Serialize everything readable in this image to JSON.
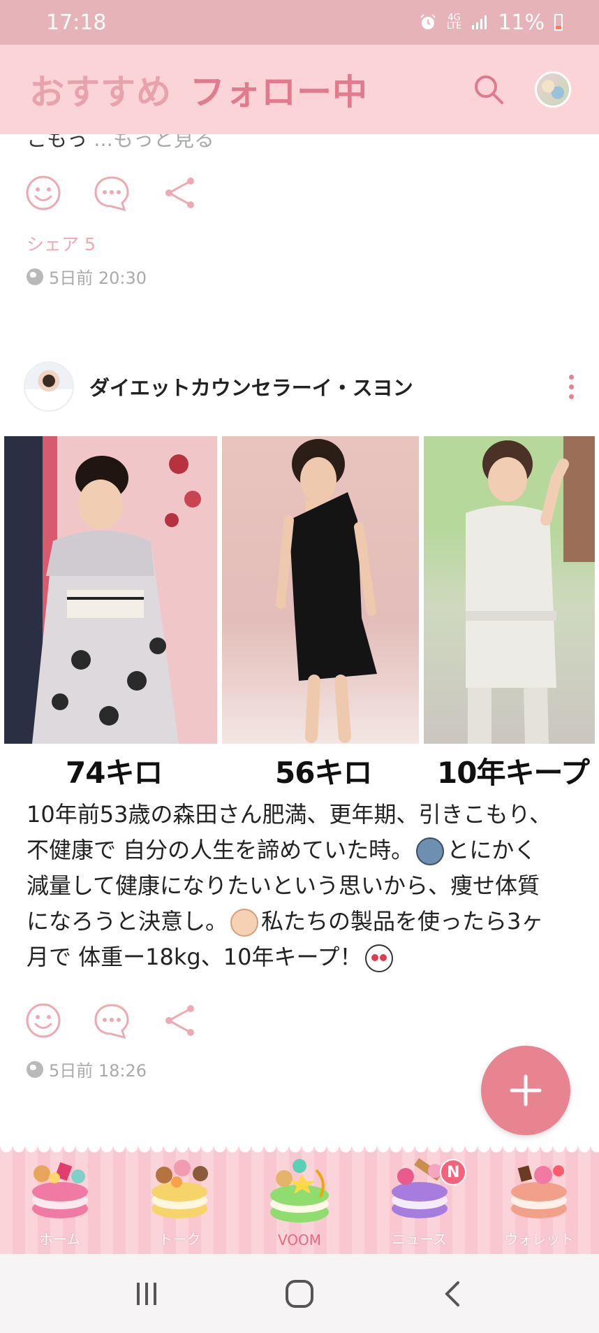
{
  "status_bar": {
    "time": "17:18",
    "network": "4G",
    "network_sub": "LTE",
    "battery": "11%"
  },
  "header": {
    "tab_recommended": "おすすめ",
    "tab_following": "フォロー中"
  },
  "prev_post": {
    "clipped_text": "こもっ",
    "more_link": "...もっと見る",
    "share_count": "シェア 5",
    "timestamp": "5日前 20:30"
  },
  "post": {
    "author": "ダイエットカウンセラーイ・スヨン",
    "captions": [
      "74キロ",
      "56キロ",
      "10年キープ"
    ],
    "text": {
      "l1": "10年前53歳の森田さん肥満、更年期、引きこもり、",
      "l2a": "不健康で 自分の人生を諦めていた時。",
      "l2b": "とにかく",
      "l3": "減量して健康になりたいという思いから、痩せ体質",
      "l4a": "になろうと決意し。",
      "l4b": "私たちの製品を使ったら3ヶ",
      "l5": "月で 体重ー18kg、10年キープ！"
    },
    "timestamp": "5日前 18:26"
  },
  "bottom_nav": {
    "items": [
      {
        "label": "ホーム",
        "icon": "macaron-home-icon"
      },
      {
        "label": "トーク",
        "icon": "macaron-talk-icon"
      },
      {
        "label": "VOOM",
        "icon": "macaron-voom-icon"
      },
      {
        "label": "ニュース",
        "icon": "macaron-news-icon",
        "badge": "N"
      },
      {
        "label": "ウォレット",
        "icon": "macaron-wallet-icon"
      }
    ],
    "active": "VOOM"
  },
  "colors": {
    "accent": "#e88490",
    "header_bg": "#fbd4d8",
    "status_bg": "#e6b3b9",
    "icon_pink": "#efa9b4"
  }
}
